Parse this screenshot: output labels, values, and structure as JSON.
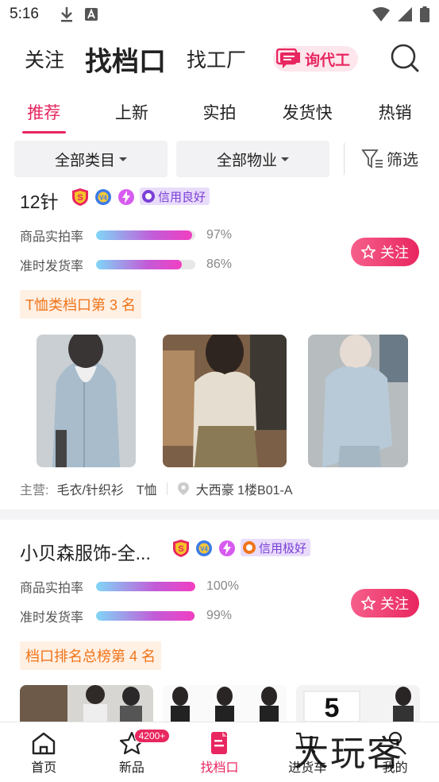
{
  "status_bar": {
    "time": "5:16"
  },
  "top_nav": {
    "tabs": [
      "关注",
      "找档口",
      "找工厂"
    ],
    "active_tab": "找档口",
    "inquiry_label": "询代工"
  },
  "sub_tabs": [
    "推荐",
    "上新",
    "实拍",
    "发货快",
    "热销"
  ],
  "filters": {
    "category": "全部类目",
    "property": "全部物业",
    "screen": "筛选"
  },
  "stores": [
    {
      "name": "12针",
      "credit": "信用良好",
      "metrics": [
        {
          "label": "商品实拍率",
          "value": "97%",
          "fraction": 0.97
        },
        {
          "label": "准时发货率",
          "value": "86%",
          "fraction": 0.86
        }
      ],
      "follow": "关注",
      "rank": "T恤类档口第 3 名",
      "main_label": "主营:",
      "main_categories": [
        "毛衣/针织衫",
        "T恤"
      ],
      "location": "大西豪 1楼B01-A"
    },
    {
      "name": "小贝森服饰-全...",
      "credit": "信用极好",
      "metrics": [
        {
          "label": "商品实拍率",
          "value": "100%",
          "fraction": 1.0
        },
        {
          "label": "准时发货率",
          "value": "99%",
          "fraction": 0.99
        }
      ],
      "follow": "关注",
      "rank": "档口排名总榜第 4 名"
    }
  ],
  "bottom_bar": {
    "items": [
      "首页",
      "新品",
      "找档口",
      "进货车",
      "我的"
    ],
    "active": "找档口",
    "new_badge": "4200+"
  },
  "watermark": "大玩客",
  "colors": {
    "accent": "#e8265f",
    "rank": "#f07418",
    "credit": "#7a3fd6"
  }
}
